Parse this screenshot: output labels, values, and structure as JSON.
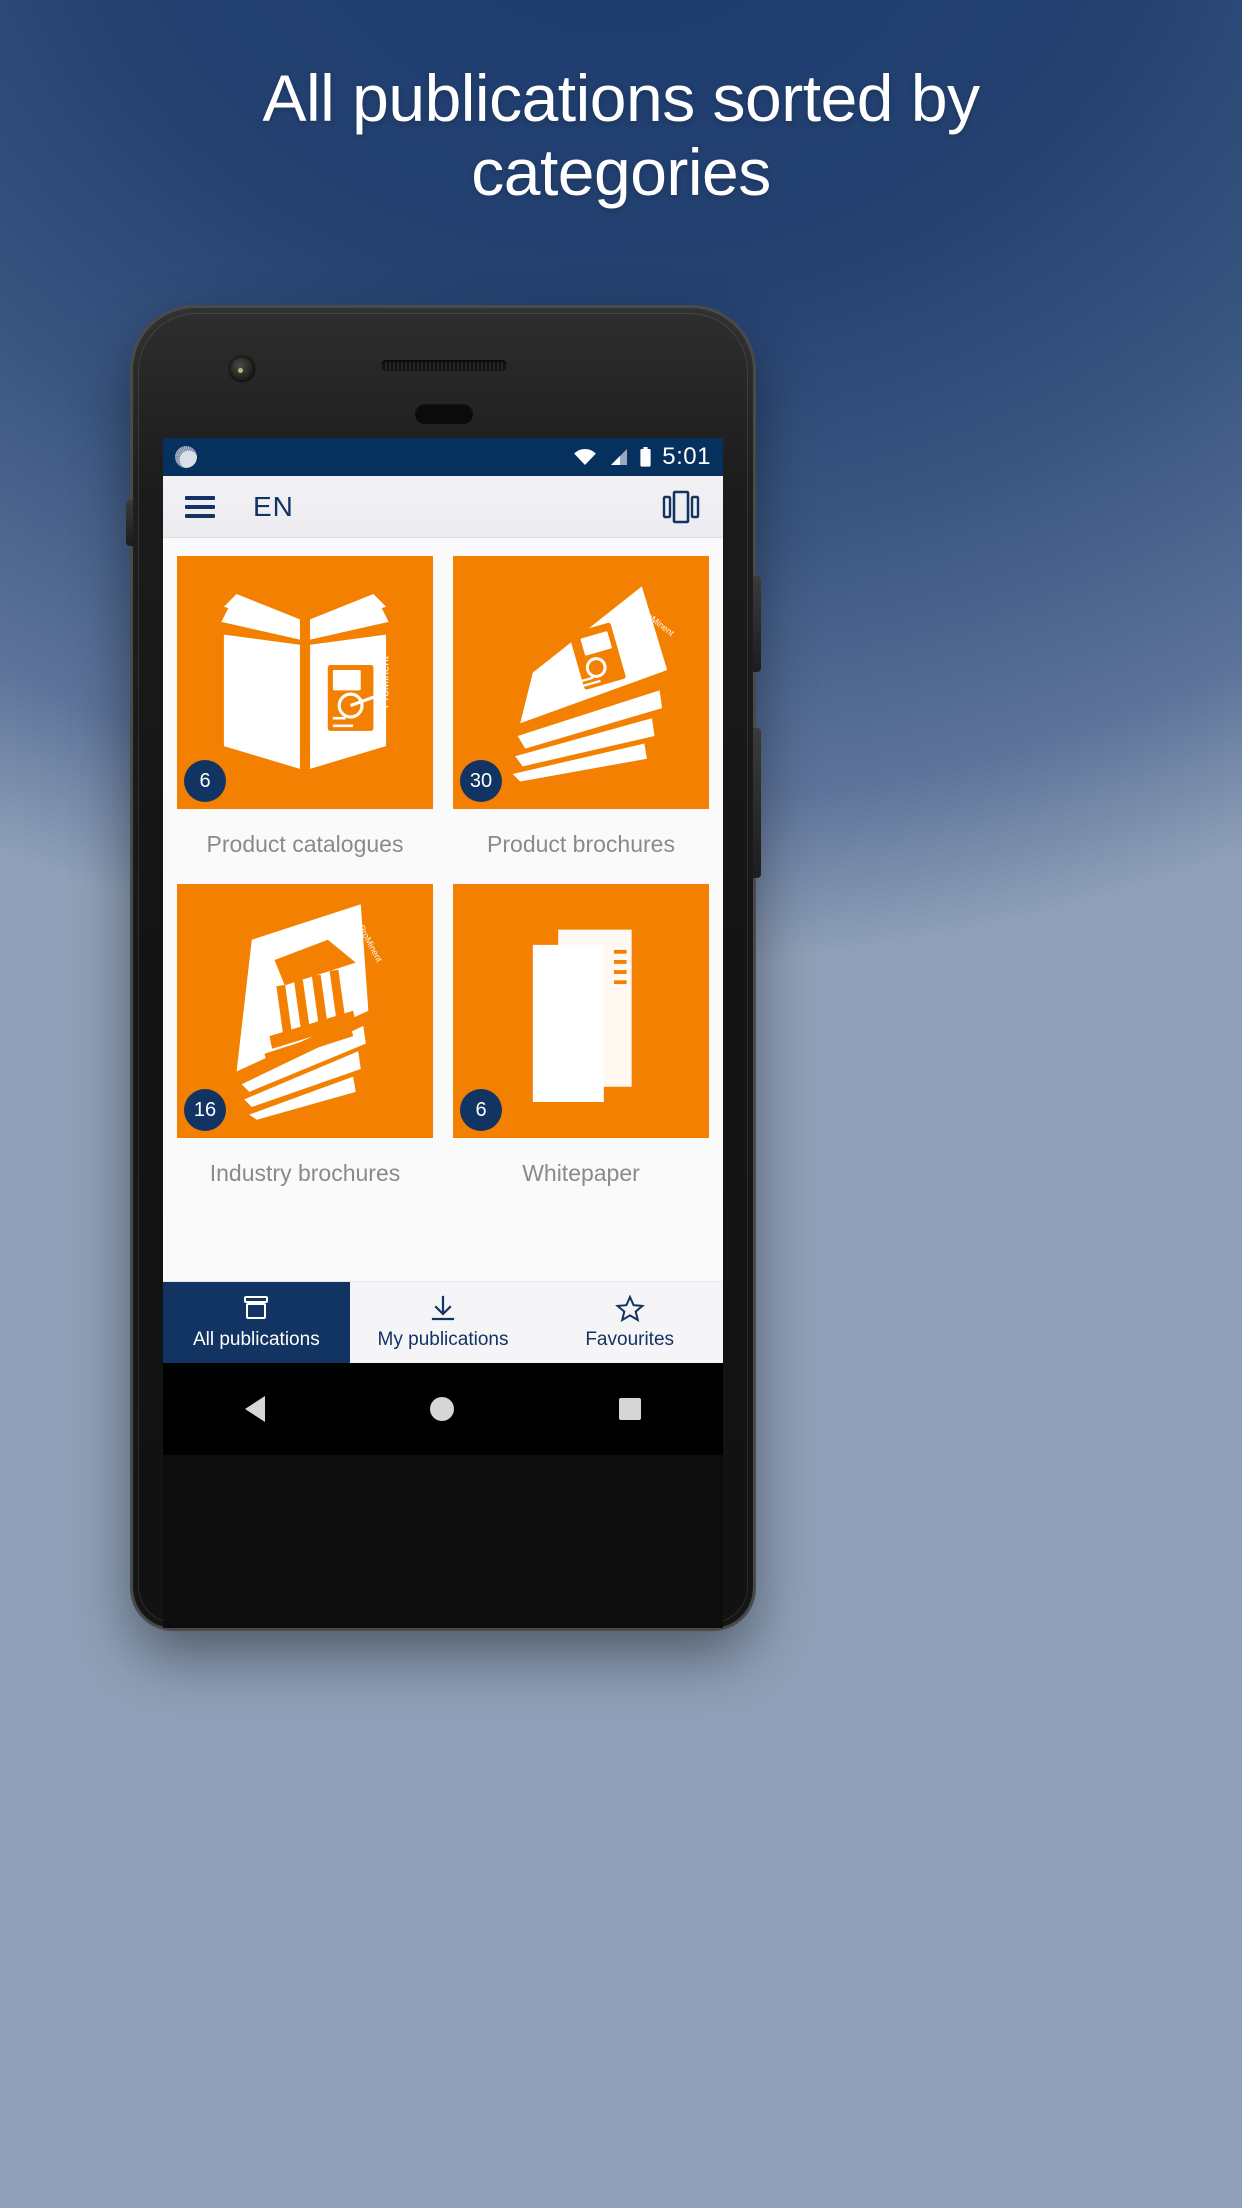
{
  "promo": {
    "headline_line1": "All publications sorted by",
    "headline_line2": "categories",
    "background_top_color": "#16306a",
    "background_bottom_color": "#b9c2cf"
  },
  "device": {
    "frame_color": "#141414",
    "statusbar": {
      "time": "5:01",
      "background_color": "#06305e",
      "icons": [
        "sync-spinner-icon",
        "wifi-icon",
        "signal-icon",
        "battery-icon"
      ]
    }
  },
  "appbar": {
    "menu_icon": "hamburger-menu-icon",
    "title": "EN",
    "view_toggle_icon": "carousel-view-icon",
    "accent_color": "#123463"
  },
  "categories": [
    {
      "label": "Product catalogues",
      "count": "6",
      "icon": "open-book-icon",
      "tile_color": "#f38000",
      "badge_color": "#123463"
    },
    {
      "label": "Product brochures",
      "count": "30",
      "icon": "fanned-brochures-icon",
      "tile_color": "#f38000",
      "badge_color": "#123463"
    },
    {
      "label": "Industry brochures",
      "count": "16",
      "icon": "museum-brochures-icon",
      "tile_color": "#f38000",
      "badge_color": "#123463"
    },
    {
      "label": "Whitepaper",
      "count": "6",
      "icon": "document-pages-icon",
      "tile_color": "#f38000",
      "badge_color": "#123463"
    }
  ],
  "bottom_nav": [
    {
      "label": "All publications",
      "icon": "archive-box-icon",
      "active": true
    },
    {
      "label": "My publications",
      "icon": "download-icon",
      "active": false
    },
    {
      "label": "Favourites",
      "icon": "star-outline-icon",
      "active": false
    }
  ],
  "android_nav": {
    "back_icon": "triangle-back-icon",
    "home_icon": "circle-home-icon",
    "recents_icon": "square-recents-icon"
  }
}
